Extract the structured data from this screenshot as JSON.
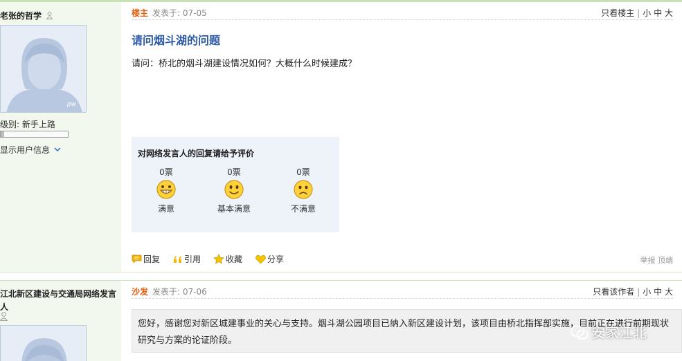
{
  "post1": {
    "author": {
      "name": "老张的哲学",
      "level_label": "级别: 新手上路",
      "level_progress": 0.05,
      "show_info": "显示用户信息",
      "avatar_tag": "pw"
    },
    "role": "楼主",
    "time": "发表于: 07-05",
    "header_links": {
      "only_author": "只看楼主",
      "small": "小",
      "medium": "中",
      "large": "大"
    },
    "title": "请问烟斗湖的问题",
    "body": "请问：桥北的烟斗湖建设情况如何？大概什么时候建成？",
    "vote": {
      "title": "对网络发言人的回复请给予评价",
      "options": [
        {
          "count": "0票",
          "label": "满意",
          "icon": "grin-face-icon"
        },
        {
          "count": "0票",
          "label": "基本满意",
          "icon": "smile-face-icon"
        },
        {
          "count": "0票",
          "label": "不满意",
          "icon": "sad-face-icon"
        }
      ]
    },
    "actions": {
      "reply": "回复",
      "quote": "引用",
      "favorite": "收藏",
      "share": "分享"
    },
    "footer_links": {
      "report": "举报",
      "top": "顶端"
    }
  },
  "post2": {
    "author": {
      "name": "江北新区建设与交通局网络发言人"
    },
    "role": "沙发",
    "time": "发表于: 07-06",
    "header_links": {
      "only_author": "只看该作者",
      "small": "小",
      "medium": "中",
      "large": "大"
    },
    "body": "您好，感谢您对新区城建事业的关心与支持。烟斗湖公园项目已纳入新区建设计划，该项目由桥北指挥部实施，目前正在进行前期现状研究与方案的论证阶段。"
  },
  "watermark": "安家江北",
  "colors": {
    "sidebar_bg": "#f2f8ee",
    "role": "#e06010",
    "title": "#2d5aa8",
    "vote_bg": "#edf3f9"
  }
}
